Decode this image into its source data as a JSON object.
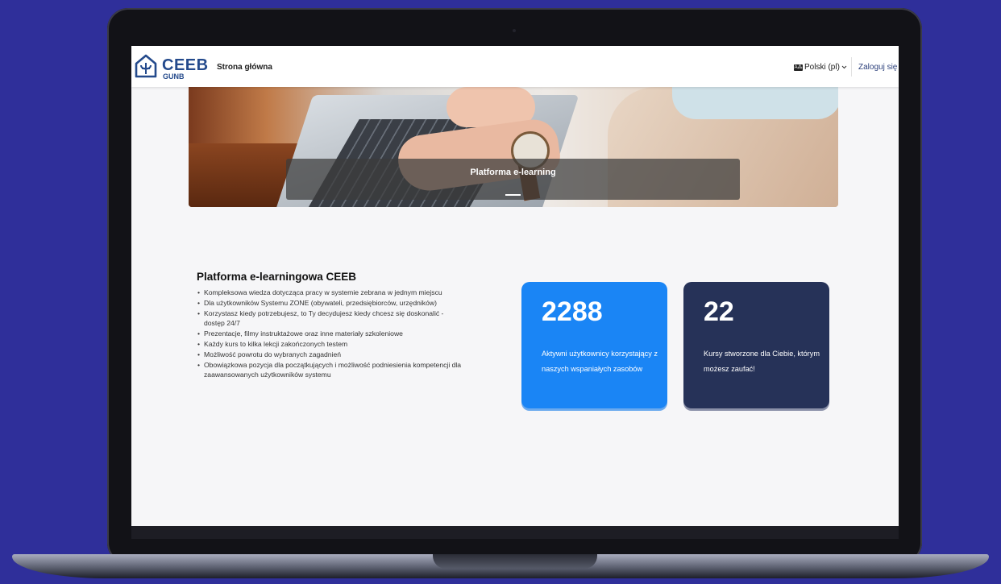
{
  "brand": {
    "name": "CEEB",
    "sub": "GUNB"
  },
  "nav": {
    "home": "Strona główna",
    "language": "Polski (pl)",
    "login": "Zaloguj się"
  },
  "hero": {
    "caption": "Platforma e-learning"
  },
  "intro": {
    "title": "Platforma e-learningowa CEEB",
    "items": [
      "Kompleksowa wiedza dotycząca pracy w systemie zebrana w jednym miejscu",
      "Dla użytkowników Systemu ZONE (obywateli, przedsiębiorców, urzędników)",
      "Korzystasz kiedy potrzebujesz, to Ty decydujesz kiedy chcesz się doskonalić - dostęp 24/7",
      "Prezentacje, filmy instruktażowe oraz inne materiały szkoleniowe",
      "Każdy kurs to kilka lekcji zakończonych testem",
      "Możliwość powrotu do wybranych zagadnień",
      "Obowiązkowa pozycja dla początkujących i możliwość podniesienia kompetencji dla zaawansowanych użytkowników systemu"
    ]
  },
  "stats": [
    {
      "number": "2288",
      "description": "Aktywni użytkownicy korzystający z naszych wspaniałych zasobów",
      "color": "#1a85f5"
    },
    {
      "number": "22",
      "description": "Kursy stworzone dla Ciebie, którym możesz zaufać!",
      "color": "#263258"
    }
  ],
  "colors": {
    "background": "#2f2f9a",
    "brand": "#244a8c"
  }
}
